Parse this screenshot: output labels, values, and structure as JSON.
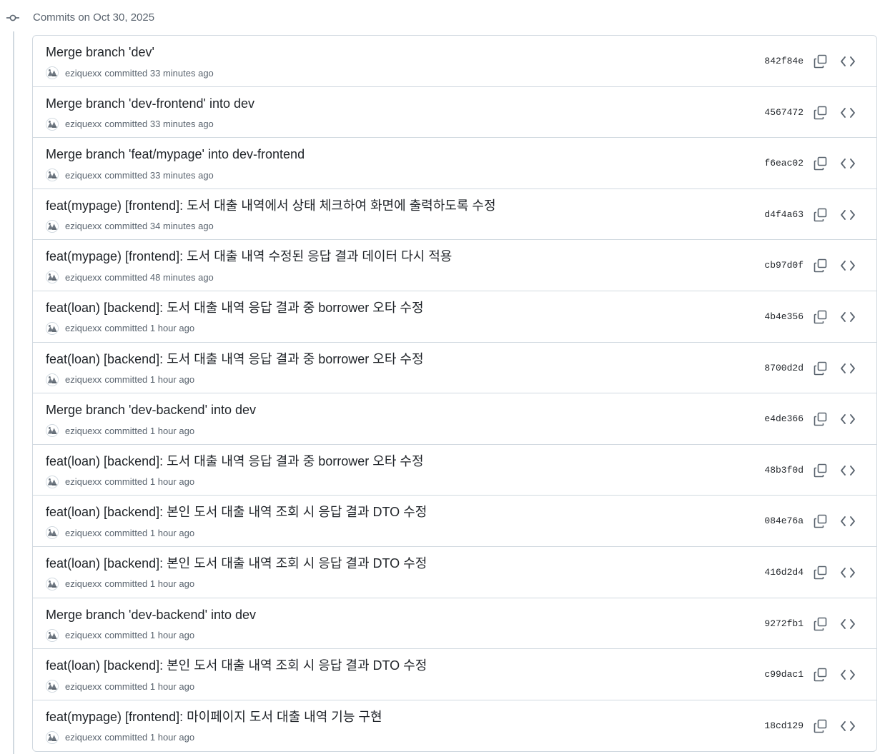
{
  "group": {
    "title": "Commits on Oct 30, 2025",
    "icon": "git-commit-icon"
  },
  "colors": {
    "text": "#1f2328",
    "muted": "#59636e",
    "border": "#d1d9e0"
  },
  "commits": [
    {
      "title": "Merge branch 'dev'",
      "author": "eziquexx",
      "time": "committed 33 minutes ago",
      "sha": "842f84e"
    },
    {
      "title": "Merge branch 'dev-frontend' into dev",
      "author": "eziquexx",
      "time": "committed 33 minutes ago",
      "sha": "4567472"
    },
    {
      "title": "Merge branch 'feat/mypage' into dev-frontend",
      "author": "eziquexx",
      "time": "committed 33 minutes ago",
      "sha": "f6eac02"
    },
    {
      "title": "feat(mypage) [frontend]: 도서 대출 내역에서 상태 체크하여 화면에 출력하도록 수정",
      "author": "eziquexx",
      "time": "committed 34 minutes ago",
      "sha": "d4f4a63"
    },
    {
      "title": "feat(mypage) [frontend]: 도서 대출 내역 수정된 응답 결과 데이터 다시 적용",
      "author": "eziquexx",
      "time": "committed 48 minutes ago",
      "sha": "cb97d0f"
    },
    {
      "title": "feat(loan) [backend]: 도서 대출 내역 응답 결과 중 borrower 오타 수정",
      "author": "eziquexx",
      "time": "committed 1 hour ago",
      "sha": "4b4e356"
    },
    {
      "title": "feat(loan) [backend]: 도서 대출 내역 응답 결과 중 borrower 오타 수정",
      "author": "eziquexx",
      "time": "committed 1 hour ago",
      "sha": "8700d2d"
    },
    {
      "title": "Merge branch 'dev-backend' into dev",
      "author": "eziquexx",
      "time": "committed 1 hour ago",
      "sha": "e4de366"
    },
    {
      "title": "feat(loan) [backend]: 도서 대출 내역 응답 결과 중 borrower 오타 수정",
      "author": "eziquexx",
      "time": "committed 1 hour ago",
      "sha": "48b3f0d"
    },
    {
      "title": "feat(loan) [backend]: 본인 도서 대출 내역 조회 시 응답 결과 DTO 수정",
      "author": "eziquexx",
      "time": "committed 1 hour ago",
      "sha": "084e76a"
    },
    {
      "title": "feat(loan) [backend]: 본인 도서 대출 내역 조회 시 응답 결과 DTO 수정",
      "author": "eziquexx",
      "time": "committed 1 hour ago",
      "sha": "416d2d4"
    },
    {
      "title": "Merge branch 'dev-backend' into dev",
      "author": "eziquexx",
      "time": "committed 1 hour ago",
      "sha": "9272fb1"
    },
    {
      "title": "feat(loan) [backend]: 본인 도서 대출 내역 조회 시 응답 결과 DTO 수정",
      "author": "eziquexx",
      "time": "committed 1 hour ago",
      "sha": "c99dac1"
    },
    {
      "title": "feat(mypage) [frontend]: 마이페이지 도서 대출 내역 기능 구현",
      "author": "eziquexx",
      "time": "committed 1 hour ago",
      "sha": "18cd129"
    }
  ]
}
